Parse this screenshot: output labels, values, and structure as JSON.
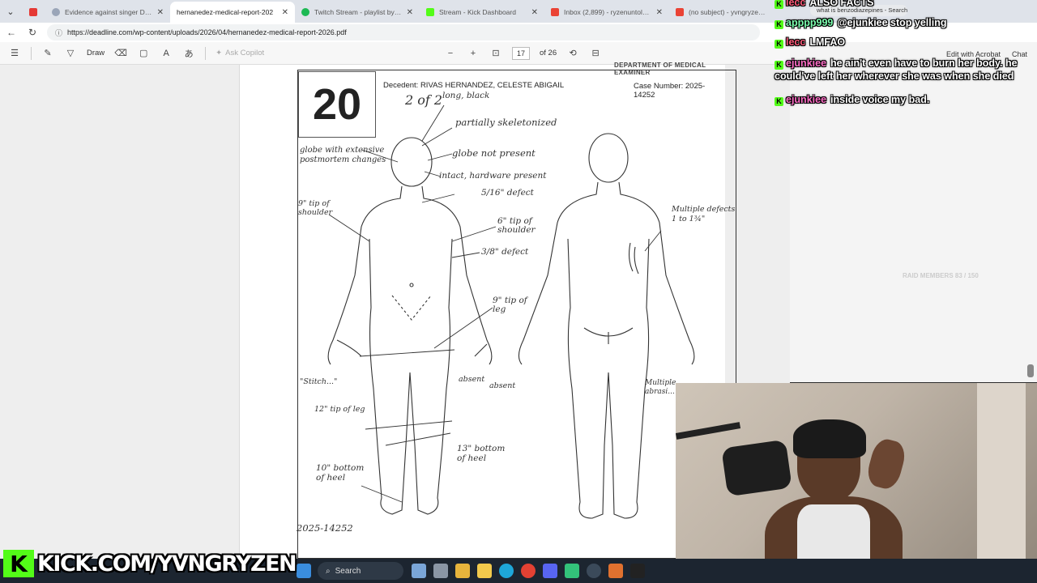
{
  "browser": {
    "tabs": [
      {
        "title": "",
        "color": "#e53935",
        "active": false
      },
      {
        "title": "Evidence against singer D4vd in",
        "color": "#9aa5b8",
        "active": false
      },
      {
        "title": "hernanedez-medical-report-202",
        "color": "#d32f2f",
        "active": true
      },
      {
        "title": "Twitch Stream - playlist by Yvng",
        "color": "#1db954",
        "active": false
      },
      {
        "title": "Stream - Kick Dashboard",
        "color": "#53fc18",
        "active": false
      },
      {
        "title": "Inbox (2,899) - ryzenuntold@gm",
        "color": "#ea4335",
        "active": false
      },
      {
        "title": "(no subject) - yvngryzenbusine",
        "color": "#ea4335",
        "active": false
      }
    ],
    "url": "https://deadline.com/wp-content/uploads/2026/04/hernanedez-medical-report-2026.pdf",
    "mini_search": "what is benzodiazepines - Search"
  },
  "pdf_toolbar": {
    "draw_label": "Draw",
    "copilot_label": "Ask Copilot",
    "page_current": "17",
    "page_total": "of 26",
    "acrobat_label": "Edit with Acrobat",
    "chat_label": "Chat"
  },
  "pdf_page": {
    "header_small": "DEPARTMENT OF MEDICAL EXAMINER",
    "page_number": "20",
    "decedent": "Decedent: RIVAS HERNANDEZ, CELESTE ABIGAIL",
    "case_number": "Case Number: 2025-14252",
    "annotations": {
      "two_of_two": "2 of 2",
      "hair": "long, black",
      "skeletonized": "partially skeletonized",
      "globe_left": "globe with extensive postmortem changes",
      "globe_not_present": "globe not present",
      "intact_hardware": "intact, hardware present",
      "defect_516": "5/16\" defect",
      "shoulder_9": "9\" tip of shoulder",
      "shoulder_6": "6\" tip of shoulder",
      "defect_38": "3/8\" defect",
      "leg_9": "9\" tip of leg",
      "stitch": "\"Stitch...\"",
      "absent_1": "absent",
      "absent_2": "absent",
      "leg_12": "12\" tip of leg",
      "bottom_heel_13": "13\" bottom of heel",
      "bottom_heel_10": "10\" bottom of heel",
      "case_hw": "2025-14252",
      "multiple_defects": "Multiple defects 1 to 1¾\"",
      "multiple_abrasions": "Multiple abrasi..."
    }
  },
  "chat": {
    "messages": [
      {
        "user": "lecc",
        "text": "ALSO FACTS"
      },
      {
        "user": "apppp999",
        "text": "@ejunkiee stop yelling"
      },
      {
        "user": "lecc",
        "text": "LMFAO"
      },
      {
        "user": "ejunkiee",
        "text": "he ain't even have to burn her body. he could've left her wherever she was when she died"
      },
      {
        "user": "ejunkiee",
        "text": "inside voice my bad."
      }
    ],
    "members": "RAID MEMBERS 83 / 150"
  },
  "taskbar": {
    "search_label": "Search"
  },
  "overlay": {
    "kick_letter": "K",
    "kick_url": "KICK.COM/YVNGRYZEN"
  },
  "colors": {
    "kick_green": "#53fc18",
    "taskbar": "#1c2530"
  }
}
